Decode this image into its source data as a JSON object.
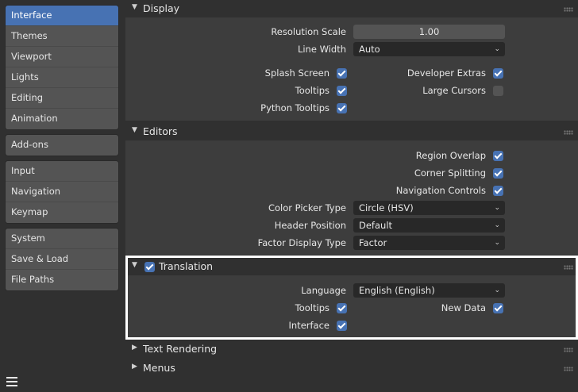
{
  "sidebar": {
    "groups": [
      [
        "Interface",
        "Themes",
        "Viewport",
        "Lights",
        "Editing",
        "Animation"
      ],
      [
        "Add-ons"
      ],
      [
        "Input",
        "Navigation",
        "Keymap"
      ],
      [
        "System",
        "Save & Load",
        "File Paths"
      ]
    ],
    "active": "Interface"
  },
  "display": {
    "title": "Display",
    "resolution_scale_label": "Resolution Scale",
    "resolution_scale_value": "1.00",
    "line_width_label": "Line Width",
    "line_width_value": "Auto",
    "splash_screen_label": "Splash Screen",
    "tooltips_label": "Tooltips",
    "python_tooltips_label": "Python Tooltips",
    "developer_extras_label": "Developer Extras",
    "large_cursors_label": "Large Cursors",
    "splash_screen": true,
    "tooltips": true,
    "python_tooltips": true,
    "developer_extras": true,
    "large_cursors": false
  },
  "editors": {
    "title": "Editors",
    "region_overlap_label": "Region Overlap",
    "corner_splitting_label": "Corner Splitting",
    "navigation_controls_label": "Navigation Controls",
    "color_picker_type_label": "Color Picker Type",
    "color_picker_type_value": "Circle (HSV)",
    "header_position_label": "Header Position",
    "header_position_value": "Default",
    "factor_display_type_label": "Factor Display Type",
    "factor_display_type_value": "Factor"
  },
  "translation": {
    "title": "Translation",
    "enabled": true,
    "language_label": "Language",
    "language_value": "English (English)",
    "tooltips_label": "Tooltips",
    "interface_label": "Interface",
    "new_data_label": "New Data"
  },
  "text_rendering": {
    "title": "Text Rendering"
  },
  "menus": {
    "title": "Menus"
  },
  "colors": {
    "accent": "#4772b3",
    "highlight_border": "#ffffff"
  }
}
